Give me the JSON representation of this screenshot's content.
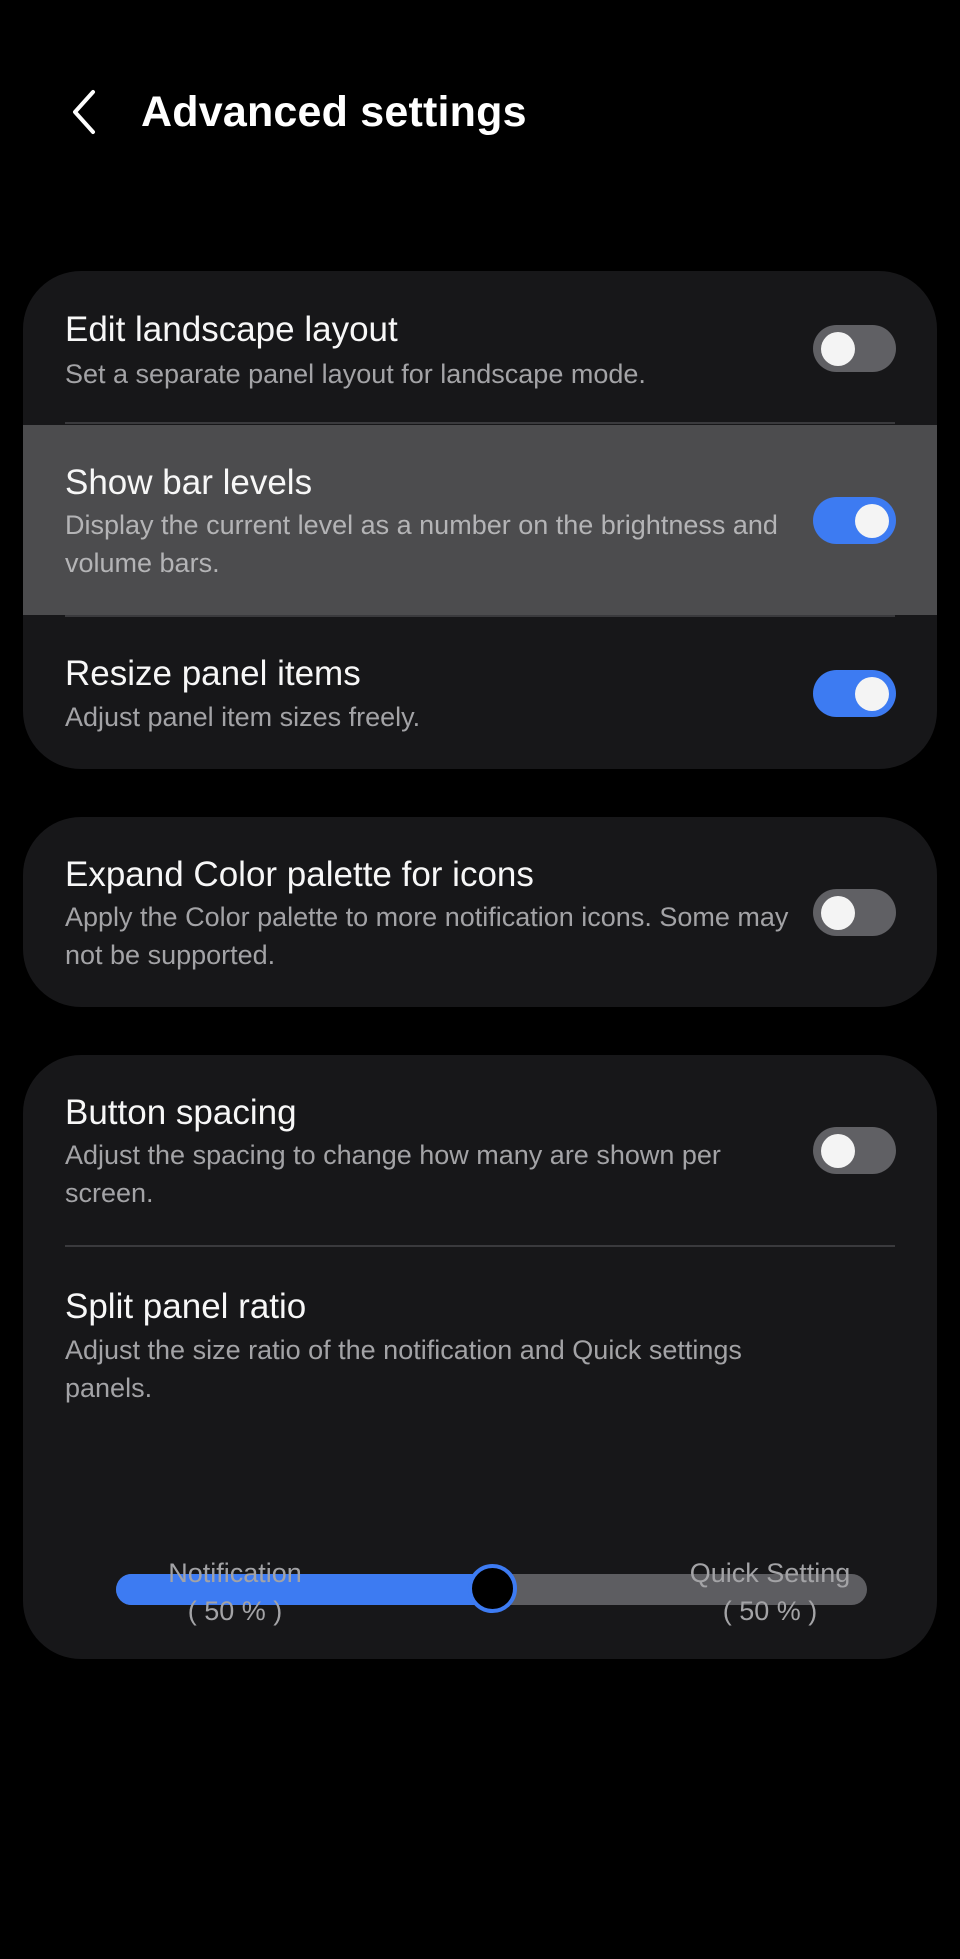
{
  "header": {
    "title": "Advanced settings",
    "back_icon": "chevron-left-icon"
  },
  "colors": {
    "background": "#000000",
    "card": "#171719",
    "highlight": "#4c4c4e",
    "accent": "#3d7bf2",
    "toggle_off": "#606064"
  },
  "card1": {
    "items": [
      {
        "title": "Edit landscape layout",
        "description": "Set a separate panel layout for landscape mode.",
        "enabled": false
      },
      {
        "title": "Show bar levels",
        "description": "Display the current level as a number on the brightness and volume bars.",
        "enabled": true
      },
      {
        "title": "Resize panel items",
        "description": "Adjust panel item sizes freely.",
        "enabled": true
      }
    ]
  },
  "card2": {
    "items": [
      {
        "title": "Expand Color palette for icons",
        "description": "Apply the Color palette to more notification icons. Some may not be supported.",
        "enabled": false
      }
    ]
  },
  "card3": {
    "button_spacing": {
      "title": "Button spacing",
      "description": "Adjust the spacing to change how many are shown per screen.",
      "enabled": false
    },
    "split_panel": {
      "title": "Split panel ratio",
      "description": "Adjust the size ratio of the notification and Quick settings panels.",
      "value_fraction": 0.5,
      "left_label": "Notification",
      "left_value": "( 50 % )",
      "right_label": "Quick Setting",
      "right_value": "( 50 % )"
    }
  }
}
